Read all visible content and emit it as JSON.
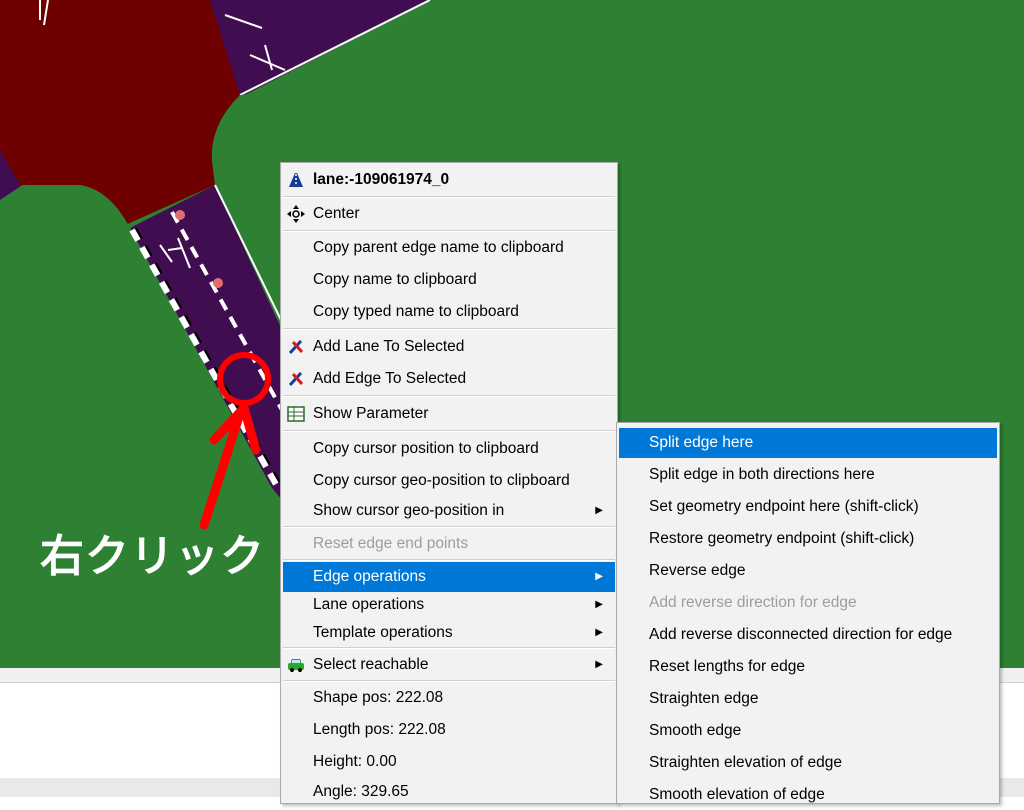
{
  "colors": {
    "grass": "#2e8032",
    "road": "#400e50",
    "junction": "#6e0000",
    "highlight": "#0078d7",
    "annotation": "#ff0000"
  },
  "annotation": {
    "text": "右クリック"
  },
  "context_menu": {
    "title": {
      "label": "lane:-109061974_0",
      "icon": "lane-icon"
    },
    "center": {
      "label": "Center",
      "icon": "move-icon"
    },
    "copy_parent_edge_name": "Copy parent edge name to clipboard",
    "copy_name": "Copy name to clipboard",
    "copy_typed_name": "Copy typed name to clipboard",
    "add_lane_to_selected": {
      "label": "Add Lane To Selected",
      "icon": "select-icon"
    },
    "add_edge_to_selected": {
      "label": "Add Edge To Selected",
      "icon": "select-icon"
    },
    "show_parameter": {
      "label": "Show Parameter",
      "icon": "table-icon"
    },
    "copy_cursor_position": "Copy cursor position to clipboard",
    "copy_cursor_geo_position": "Copy cursor geo-position to clipboard",
    "show_cursor_geo_position_in": "Show cursor geo-position in",
    "reset_edge_end_points": "Reset edge end points",
    "edge_operations": "Edge operations",
    "lane_operations": "Lane operations",
    "template_operations": "Template operations",
    "select_reachable": {
      "label": "Select reachable",
      "icon": "car-icon"
    },
    "shape_pos": "Shape pos: 222.08",
    "length_pos": "Length pos: 222.08",
    "height": "Height: 0.00",
    "angle": "Angle: 329.65"
  },
  "edge_submenu": {
    "split_edge_here": "Split edge here",
    "split_edge_both": "Split edge in both directions here",
    "set_geometry_endpoint": "Set geometry endpoint here (shift-click)",
    "restore_geometry_endpoint": "Restore geometry endpoint (shift-click)",
    "reverse_edge": "Reverse edge",
    "add_reverse_direction": "Add reverse direction for edge",
    "add_reverse_disconnected": "Add reverse disconnected direction for edge",
    "reset_lengths": "Reset lengths for edge",
    "straighten_edge": "Straighten edge",
    "smooth_edge": "Smooth edge",
    "straighten_elevation": "Straighten elevation of edge",
    "smooth_elevation": "Smooth elevation of edge"
  }
}
